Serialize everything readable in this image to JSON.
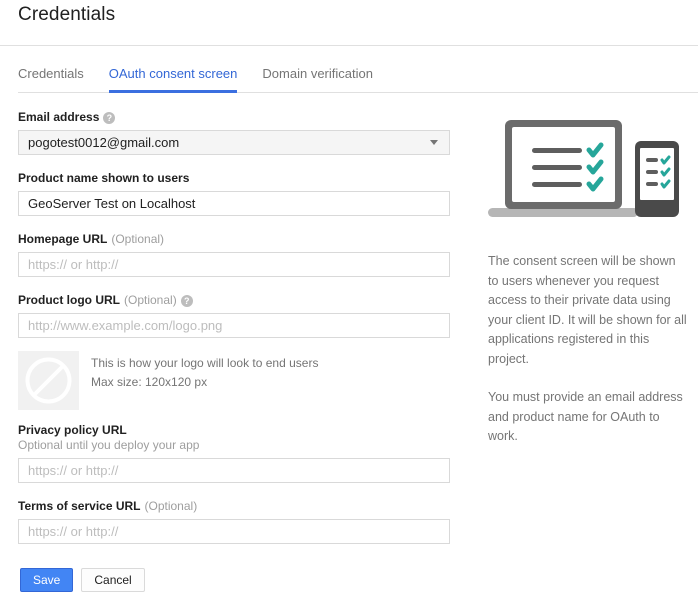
{
  "header": {
    "title": "Credentials"
  },
  "tabs": [
    {
      "label": "Credentials",
      "active": false
    },
    {
      "label": "OAuth consent screen",
      "active": true
    },
    {
      "label": "Domain verification",
      "active": false
    }
  ],
  "form": {
    "email": {
      "label": "Email address",
      "help_icon": "help-icon",
      "value": "pogotest0012@gmail.com",
      "caret_icon": "chevron-down-icon"
    },
    "product_name": {
      "label": "Product name shown to users",
      "value": "GeoServer Test on Localhost"
    },
    "homepage_url": {
      "label": "Homepage URL",
      "optional": "(Optional)",
      "placeholder": "https:// or http://",
      "value": ""
    },
    "product_logo_url": {
      "label": "Product logo URL",
      "optional": "(Optional)",
      "help_icon": "help-icon",
      "placeholder": "http://www.example.com/logo.png",
      "value": ""
    },
    "logo_preview": {
      "icon": "no-image-icon",
      "line1": "This is how your logo will look to end users",
      "line2": "Max size: 120x120 px"
    },
    "privacy_policy_url": {
      "label": "Privacy policy URL",
      "sub_label": "Optional until you deploy your app",
      "placeholder": "https:// or http://",
      "value": ""
    },
    "terms_of_service_url": {
      "label": "Terms of service URL",
      "optional": "(Optional)",
      "placeholder": "https:// or http://",
      "value": ""
    }
  },
  "buttons": {
    "save": "Save",
    "cancel": "Cancel"
  },
  "info": {
    "illustration_name": "laptop-phone-checklist-illustration",
    "paragraph1": "The consent screen will be shown to users whenever you request access to their private data using your client ID. It will be shown for all applications registered in this project.",
    "paragraph2": "You must provide an email address and product name for OAuth to work."
  },
  "colors": {
    "accent_blue": "#4285f4",
    "tab_active": "#3367d6",
    "check_teal": "#26a69a",
    "device_gray": "#6b6b6b",
    "text_muted": "#757575",
    "border": "#d9d9d9"
  }
}
